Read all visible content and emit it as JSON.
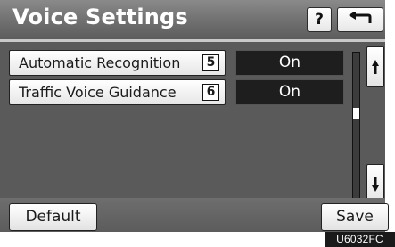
{
  "header": {
    "title": "Voice Settings",
    "help_label": "?"
  },
  "settings": [
    {
      "label": "Automatic Recognition",
      "ref_number": "5",
      "value": "On"
    },
    {
      "label": "Traffic Voice Guidance",
      "ref_number": "6",
      "value": "On"
    }
  ],
  "footer": {
    "default_label": "Default",
    "save_label": "Save"
  },
  "figure_code": "U6032FC",
  "icons": {
    "back": "back-arrow-icon",
    "scroll_up": "scroll-up-icon",
    "scroll_down": "scroll-down-icon"
  }
}
